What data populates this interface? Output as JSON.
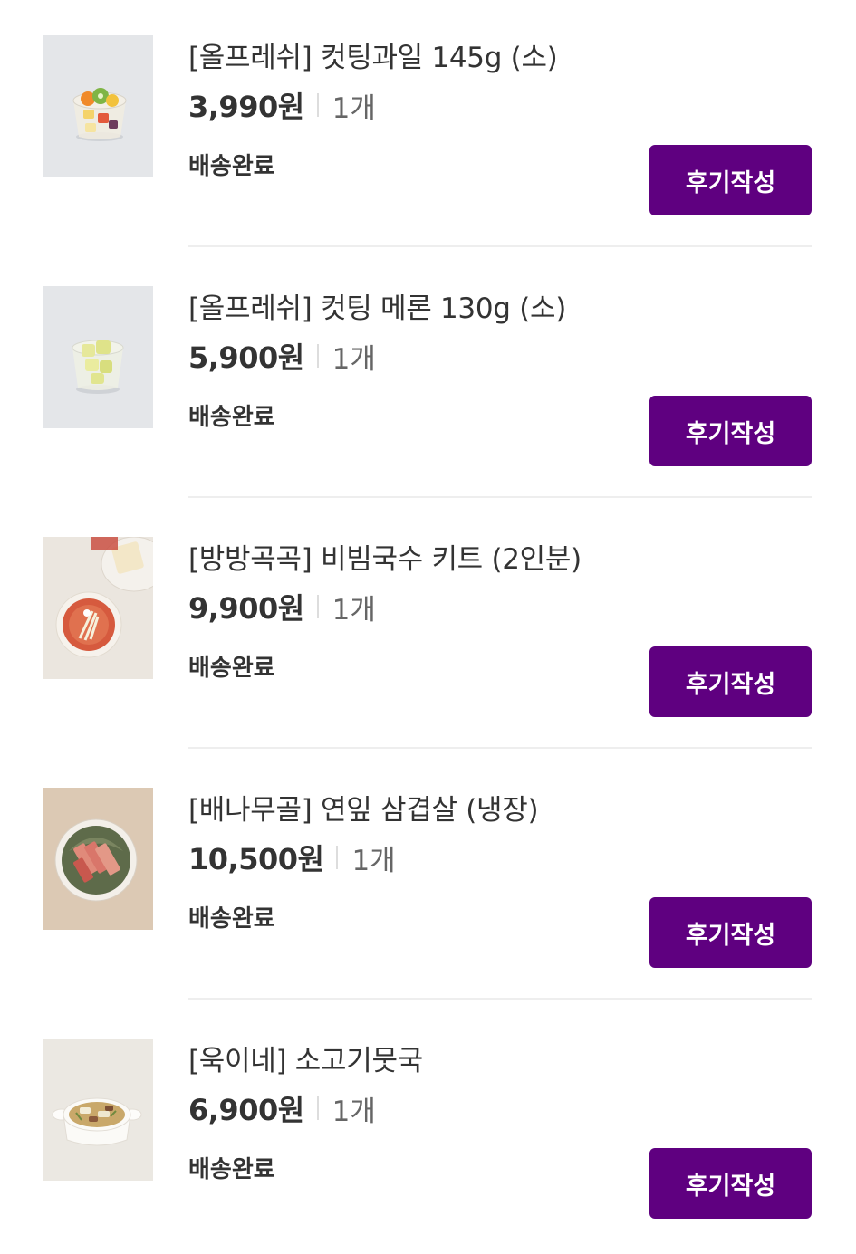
{
  "orders": [
    {
      "name": "[올프레쉬] 컷팅과일 145g (소)",
      "price": "3,990원",
      "quantity": "1개",
      "status": "배송완료",
      "review_label": "후기작성",
      "thumbnail": "cut-fruit-cup"
    },
    {
      "name": "[올프레쉬] 컷팅 메론 130g (소)",
      "price": "5,900원",
      "quantity": "1개",
      "status": "배송완료",
      "review_label": "후기작성",
      "thumbnail": "cut-melon-cup"
    },
    {
      "name": "[방방곡곡] 비빔국수 키트 (2인분)",
      "price": "9,900원",
      "quantity": "1개",
      "status": "배송완료",
      "review_label": "후기작성",
      "thumbnail": "bibim-noodle-kit"
    },
    {
      "name": "[배나무골] 연잎 삼겹살 (냉장)",
      "price": "10,500원",
      "quantity": "1개",
      "status": "배송완료",
      "review_label": "후기작성",
      "thumbnail": "lotus-leaf-pork-belly"
    },
    {
      "name": "[욱이네] 소고기뭇국",
      "price": "6,900원",
      "quantity": "1개",
      "status": "배송완료",
      "review_label": "후기작성",
      "thumbnail": "beef-radish-soup"
    }
  ],
  "colors": {
    "button_bg": "#5f0080",
    "button_text": "#ffffff",
    "text_primary": "#333333",
    "text_secondary": "#666666",
    "divider": "#eeeeee"
  }
}
